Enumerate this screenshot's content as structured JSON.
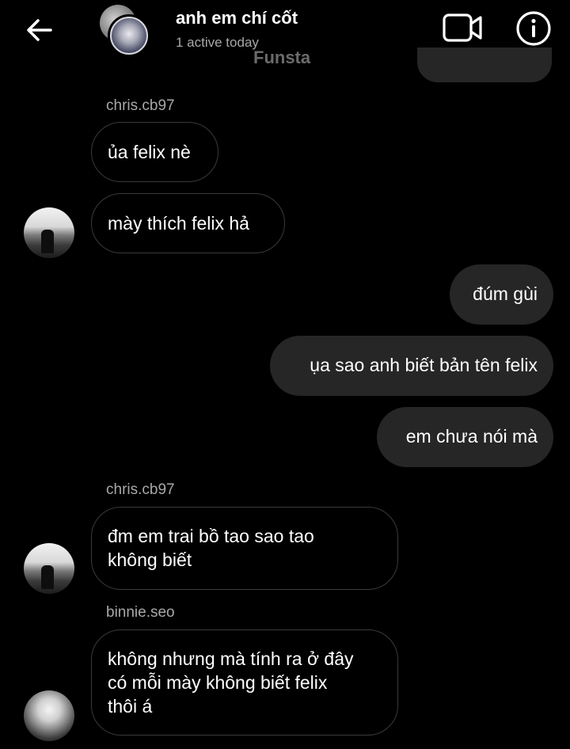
{
  "header": {
    "title": "anh em chí cốt",
    "status": "1 active today",
    "watermark": "Funsta"
  },
  "icons": {
    "back": "arrow-left-icon",
    "video": "video-camera-icon",
    "info": "info-circle-icon"
  },
  "messages": [
    {
      "sender": "chris.cb97"
    },
    {
      "text": "ủa felix nè",
      "direction": "incoming"
    },
    {
      "text": "mày thích felix hả",
      "direction": "incoming"
    },
    {
      "text": "đúm gùi",
      "direction": "outgoing"
    },
    {
      "text": "ụa sao anh biết bản tên felix",
      "direction": "outgoing"
    },
    {
      "text": "em chưa nói mà",
      "direction": "outgoing"
    },
    {
      "sender": "chris.cb97"
    },
    {
      "text": "đm em trai bồ tao sao tao\nkhông biết",
      "direction": "incoming"
    },
    {
      "sender": "binnie.seo"
    },
    {
      "text": "không nhưng mà tính ra ở đây\ncó mỗi mày không biết felix\nthôi á",
      "direction": "incoming"
    }
  ]
}
